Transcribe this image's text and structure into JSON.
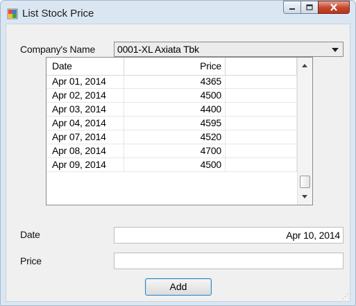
{
  "window": {
    "title": "List Stock Price",
    "controls": {
      "minimize": "minimize-icon",
      "maximize": "maximize-icon",
      "close": "close-icon"
    }
  },
  "form": {
    "company_label": "Company's Name",
    "company_value": "0001-XL Axiata Tbk",
    "date_label": "Date",
    "date_value": "Apr 10, 2014",
    "price_label": "Price",
    "price_value": "",
    "add_button": "Add"
  },
  "grid": {
    "headers": [
      "Date",
      "Price",
      ""
    ],
    "rows": [
      {
        "date": "Apr 01, 2014",
        "price": "4365"
      },
      {
        "date": "Apr 02, 2014",
        "price": "4500"
      },
      {
        "date": "Apr 03, 2014",
        "price": "4400"
      },
      {
        "date": "Apr 04, 2014",
        "price": "4595"
      },
      {
        "date": "Apr 07, 2014",
        "price": "4520"
      },
      {
        "date": "Apr 08, 2014",
        "price": "4700"
      },
      {
        "date": "Apr 09, 2014",
        "price": "4500"
      }
    ]
  }
}
